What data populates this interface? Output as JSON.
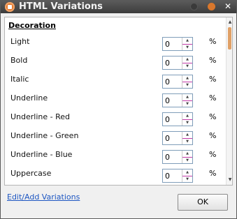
{
  "window": {
    "title": "HTML Variations"
  },
  "section": {
    "title": "Decoration"
  },
  "rows": [
    {
      "label": "Light",
      "value": "0",
      "unit": "%"
    },
    {
      "label": "Bold",
      "value": "0",
      "unit": "%"
    },
    {
      "label": "Italic",
      "value": "0",
      "unit": "%"
    },
    {
      "label": "Underline",
      "value": "0",
      "unit": "%"
    },
    {
      "label": "Underline - Red",
      "value": "0",
      "unit": "%"
    },
    {
      "label": "Underline - Green",
      "value": "0",
      "unit": "%"
    },
    {
      "label": "Underline - Blue",
      "value": "0",
      "unit": "%"
    },
    {
      "label": "Uppercase",
      "value": "0",
      "unit": "%"
    }
  ],
  "footer": {
    "link_label": "Edit/Add Variations",
    "ok_label": "OK"
  },
  "icons": {
    "app": "app-icon",
    "minimize": "minimize-icon",
    "maximize": "maximize-icon",
    "close": "close-icon",
    "spin_up": "arrow-up-icon",
    "spin_down": "arrow-down-icon"
  },
  "colors": {
    "accent": "#d9772c",
    "link": "#1d56c2",
    "titlebar": "#4a4a4a"
  }
}
